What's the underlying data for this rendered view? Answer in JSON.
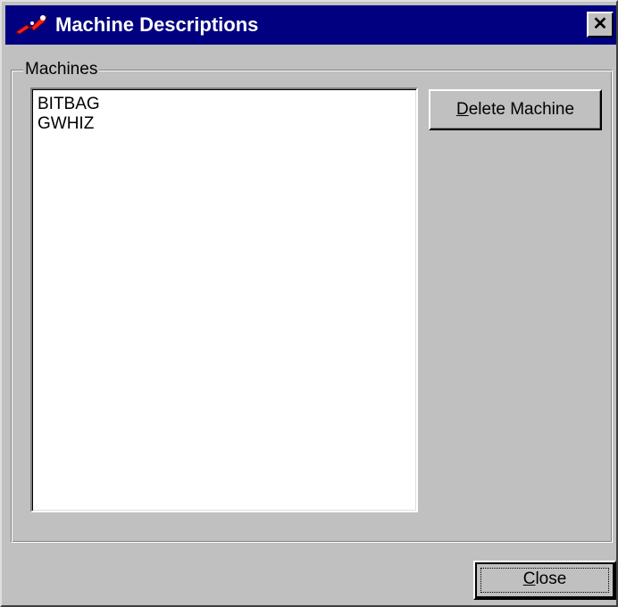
{
  "window": {
    "title": "Machine Descriptions",
    "close_glyph": "✕",
    "icon": "app-logo-icon"
  },
  "group": {
    "label": "Machines"
  },
  "machines": {
    "items": [
      "BITBAG",
      "GWHIZ"
    ]
  },
  "buttons": {
    "delete": {
      "mnemonic": "D",
      "rest": "elete Machine"
    },
    "close": {
      "mnemonic": "C",
      "rest": "lose"
    }
  },
  "colors": {
    "titlebar": "#000080",
    "face": "#c0c0c0",
    "list_bg": "#ffffff"
  }
}
